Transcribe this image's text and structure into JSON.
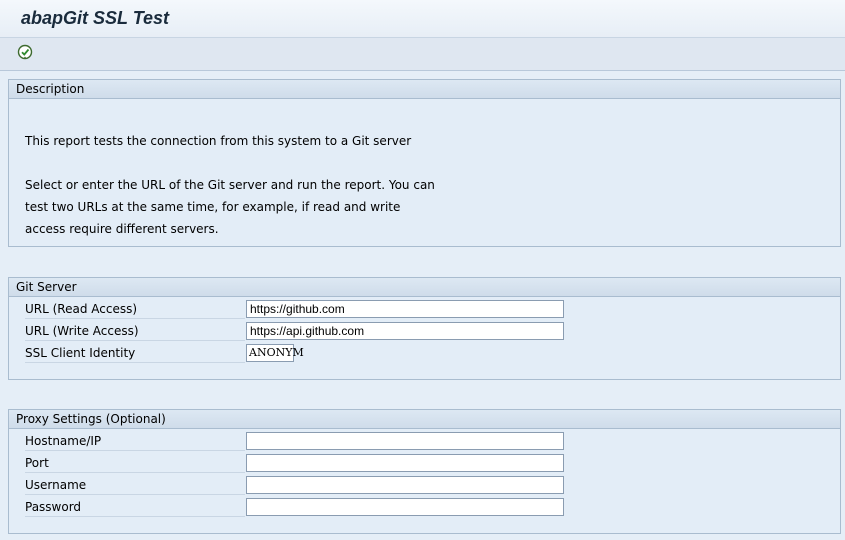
{
  "window": {
    "title": "abapGit SSL Test"
  },
  "toolbar": {
    "execute_icon": "execute-icon"
  },
  "description": {
    "header": "Description",
    "lines": [
      "This report tests the connection from this system to a Git server",
      "Select or enter the URL of the Git server and run the report. You can",
      "test two URLs at the same time, for example, if read and write",
      "access require different servers."
    ]
  },
  "git_server": {
    "header": "Git Server",
    "url_read_label": "URL (Read Access)",
    "url_read_value": "https://github.com",
    "url_write_label": "URL (Write Access)",
    "url_write_value": "https://api.github.com",
    "ssl_id_label": "SSL Client Identity",
    "ssl_id_value": "ANONYM"
  },
  "proxy": {
    "header": "Proxy Settings (Optional)",
    "host_label": "Hostname/IP",
    "host_value": "",
    "port_label": "Port",
    "port_value": "",
    "user_label": "Username",
    "user_value": "",
    "password_label": "Password",
    "password_value": ""
  }
}
